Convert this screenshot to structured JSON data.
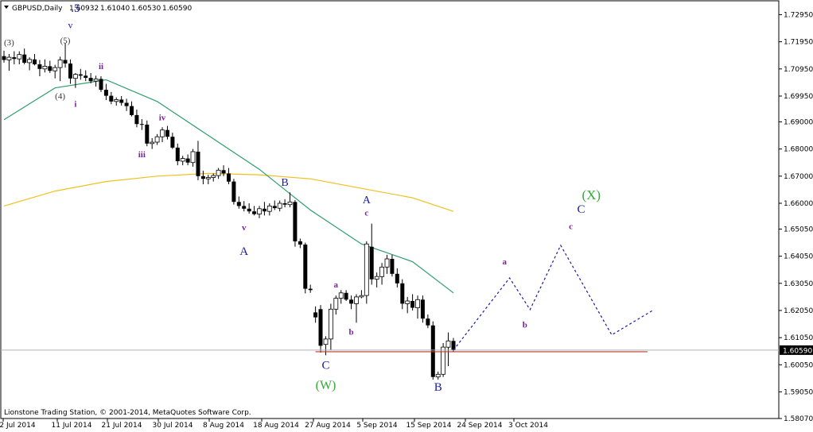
{
  "header": {
    "symbol": "GBPUSD,Daily",
    "open": "1.60932",
    "high": "1.61040",
    "low": "1.60530",
    "close": "1.60590"
  },
  "footer": {
    "copyright": "Lionstone Trading Station, © 2001-2014, MetaQuotes Software Corp."
  },
  "current_price_label": "1.60590",
  "colors": {
    "bull": "#ffffff",
    "bear": "#000000",
    "ma_fast": "#2e9e6a",
    "ma_slow": "#f0c020",
    "projection": "#1a1aa8",
    "support": "#c0392b",
    "wave_blue": "#1a1aa8",
    "wave_purple": "#7a1fa0",
    "wave_green": "#33aa33",
    "wave_black": "#333333"
  },
  "chart_data": {
    "type": "candlestick",
    "y_axis": {
      "min": 1.5807,
      "max": 1.7346,
      "ticks": [
        "1.72950",
        "1.71950",
        "1.70950",
        "1.69950",
        "1.69000",
        "1.68000",
        "1.67000",
        "1.66000",
        "1.65050",
        "1.64050",
        "1.63050",
        "1.62050",
        "1.61050",
        "1.60050",
        "1.59050",
        "1.58070"
      ]
    },
    "x_axis": {
      "labels": [
        "2 Jul 2014",
        "11 Jul 2014",
        "21 Jul 2014",
        "30 Jul 2014",
        "8 Aug 2014",
        "18 Aug 2014",
        "27 Aug 2014",
        "5 Sep 2014",
        "15 Sep 2014",
        "24 Sep 2014",
        "3 Oct 2014"
      ]
    },
    "candles": [
      [
        1.7142,
        1.7162,
        1.7118,
        1.7128
      ],
      [
        1.7128,
        1.715,
        1.7088,
        1.7138
      ],
      [
        1.7138,
        1.716,
        1.7112,
        1.7132
      ],
      [
        1.7132,
        1.716,
        1.7112,
        1.7148
      ],
      [
        1.7148,
        1.717,
        1.7112,
        1.7118
      ],
      [
        1.7118,
        1.7138,
        1.709,
        1.713
      ],
      [
        1.713,
        1.715,
        1.7108,
        1.7112
      ],
      [
        1.7112,
        1.7128,
        1.7068,
        1.7095
      ],
      [
        1.7095,
        1.713,
        1.7082,
        1.7105
      ],
      [
        1.7105,
        1.7125,
        1.708,
        1.7088
      ],
      [
        1.7088,
        1.711,
        1.706,
        1.71
      ],
      [
        1.71,
        1.714,
        1.705,
        1.7128
      ],
      [
        1.7128,
        1.719,
        1.71,
        1.7115
      ],
      [
        1.7115,
        1.713,
        1.704,
        1.706
      ],
      [
        1.706,
        1.708,
        1.7025,
        1.7075
      ],
      [
        1.7075,
        1.7095,
        1.7055,
        1.707
      ],
      [
        1.707,
        1.709,
        1.705,
        1.7062
      ],
      [
        1.7062,
        1.708,
        1.7042,
        1.705
      ],
      [
        1.705,
        1.707,
        1.703,
        1.7058
      ],
      [
        1.7058,
        1.7068,
        1.701,
        1.7018
      ],
      [
        1.7018,
        1.704,
        1.698,
        1.6996
      ],
      [
        1.6996,
        1.701,
        1.6965,
        1.6975
      ],
      [
        1.6975,
        1.699,
        1.696,
        1.6982
      ],
      [
        1.6982,
        1.6995,
        1.696,
        1.697
      ],
      [
        1.697,
        1.6985,
        1.694,
        1.6958
      ],
      [
        1.6958,
        1.6975,
        1.692,
        1.6925
      ],
      [
        1.6925,
        1.6945,
        1.688,
        1.6892
      ],
      [
        1.6892,
        1.691,
        1.687,
        1.689
      ],
      [
        1.689,
        1.6905,
        1.681,
        1.682
      ],
      [
        1.682,
        1.684,
        1.68,
        1.6825
      ],
      [
        1.6825,
        1.6855,
        1.6815,
        1.6845
      ],
      [
        1.6845,
        1.688,
        1.6825,
        1.687
      ],
      [
        1.687,
        1.6885,
        1.6835,
        1.6845
      ],
      [
        1.6845,
        1.686,
        1.68,
        1.6805
      ],
      [
        1.6805,
        1.682,
        1.674,
        1.6755
      ],
      [
        1.6755,
        1.6775,
        1.674,
        1.6765
      ],
      [
        1.6765,
        1.678,
        1.674,
        1.675
      ],
      [
        1.675,
        1.68,
        1.6735,
        1.679
      ],
      [
        1.679,
        1.683,
        1.6685,
        1.67
      ],
      [
        1.67,
        1.672,
        1.667,
        1.669
      ],
      [
        1.669,
        1.6705,
        1.667,
        1.6695
      ],
      [
        1.6695,
        1.671,
        1.668,
        1.6702
      ],
      [
        1.6702,
        1.673,
        1.669,
        1.6722
      ],
      [
        1.6722,
        1.674,
        1.67,
        1.671
      ],
      [
        1.671,
        1.673,
        1.667,
        1.668
      ],
      [
        1.668,
        1.669,
        1.6595,
        1.6605
      ],
      [
        1.6605,
        1.6625,
        1.658,
        1.659
      ],
      [
        1.659,
        1.6608,
        1.657,
        1.658
      ],
      [
        1.658,
        1.66,
        1.6562,
        1.657
      ],
      [
        1.657,
        1.659,
        1.6555,
        1.656
      ],
      [
        1.656,
        1.659,
        1.6545,
        1.658
      ],
      [
        1.658,
        1.6605,
        1.6555,
        1.657
      ],
      [
        1.657,
        1.66,
        1.6555,
        1.659
      ],
      [
        1.659,
        1.661,
        1.6575,
        1.6582
      ],
      [
        1.6582,
        1.661,
        1.657,
        1.66
      ],
      [
        1.66,
        1.6615,
        1.6585,
        1.6595
      ],
      [
        1.6595,
        1.664,
        1.6585,
        1.6605
      ],
      [
        1.6605,
        1.6612,
        1.644,
        1.646
      ],
      [
        1.646,
        1.647,
        1.6435,
        1.6448
      ],
      [
        1.6448,
        1.6455,
        1.6268,
        1.6285
      ],
      [
        1.6285,
        1.63,
        1.627,
        1.628
      ],
      [
        1.6198,
        1.622,
        1.616,
        1.618
      ],
      [
        1.621,
        1.6225,
        1.605,
        1.6075
      ],
      [
        1.608,
        1.611,
        1.604,
        1.61
      ],
      [
        1.61,
        1.623,
        1.606,
        1.621
      ],
      [
        1.621,
        1.626,
        1.619,
        1.625
      ],
      [
        1.625,
        1.628,
        1.623,
        1.627
      ],
      [
        1.627,
        1.628,
        1.624,
        1.6245
      ],
      [
        1.6245,
        1.626,
        1.621,
        1.623
      ],
      [
        1.623,
        1.6265,
        1.616,
        1.6255
      ],
      [
        1.6255,
        1.628,
        1.625,
        1.626
      ],
      [
        1.626,
        1.646,
        1.623,
        1.645
      ],
      [
        1.644,
        1.6525,
        1.63,
        1.632
      ],
      [
        1.632,
        1.6345,
        1.629,
        1.633
      ],
      [
        1.633,
        1.638,
        1.63,
        1.6365
      ],
      [
        1.6365,
        1.641,
        1.634,
        1.6395
      ],
      [
        1.6395,
        1.641,
        1.633,
        1.634
      ],
      [
        1.634,
        1.636,
        1.629,
        1.6305
      ],
      [
        1.6305,
        1.632,
        1.621,
        1.623
      ],
      [
        1.623,
        1.6255,
        1.6195,
        1.624
      ],
      [
        1.624,
        1.6265,
        1.6205,
        1.6215
      ],
      [
        1.6215,
        1.626,
        1.6175,
        1.6245
      ],
      [
        1.6245,
        1.626,
        1.616,
        1.6175
      ],
      [
        1.6175,
        1.619,
        1.614,
        1.615
      ],
      [
        1.615,
        1.6165,
        1.595,
        1.596
      ],
      [
        1.596,
        1.598,
        1.595,
        1.597
      ],
      [
        1.597,
        1.6085,
        1.596,
        1.607
      ],
      [
        1.607,
        1.6124,
        1.6,
        1.6093
      ],
      [
        1.6093,
        1.6104,
        1.6053,
        1.6059
      ]
    ],
    "ma_fast": [
      [
        0,
        1.6908
      ],
      [
        10,
        1.7025
      ],
      [
        20,
        1.7055
      ],
      [
        30,
        1.6975
      ],
      [
        40,
        1.685
      ],
      [
        50,
        1.6725
      ],
      [
        60,
        1.6575
      ],
      [
        70,
        1.645
      ],
      [
        80,
        1.6385
      ],
      [
        88,
        1.627
      ]
    ],
    "ma_slow": [
      [
        0,
        1.659
      ],
      [
        10,
        1.6645
      ],
      [
        20,
        1.668
      ],
      [
        30,
        1.67
      ],
      [
        40,
        1.671
      ],
      [
        50,
        1.6705
      ],
      [
        60,
        1.669
      ],
      [
        70,
        1.6655
      ],
      [
        80,
        1.662
      ],
      [
        88,
        1.657
      ]
    ],
    "projection": [
      [
        88,
        1.6059
      ],
      [
        99,
        1.6325
      ],
      [
        103,
        1.6208
      ],
      [
        109,
        1.6445
      ],
      [
        119,
        1.6115
      ],
      [
        127,
        1.6205
      ]
    ],
    "support_level": 1.6053,
    "current_price": 1.6059,
    "wave_labels": [
      {
        "text": "(3)",
        "i": 1,
        "y": 1.7182,
        "style": "wave_black",
        "size": 11
      },
      {
        "text": "(5)",
        "i": 12,
        "y": 1.719,
        "style": "wave_black",
        "size": 11
      },
      {
        "text": "v",
        "i": 13,
        "y": 1.7245,
        "style": "wave_blue",
        "size": 12
      },
      {
        "text": ".5",
        "i": 14,
        "y": 1.7305,
        "style": "wave_blue",
        "size": 15
      },
      {
        "text": "(4)",
        "i": 11,
        "y": 1.6985,
        "style": "wave_black",
        "size": 11
      },
      {
        "text": "ii",
        "i": 19,
        "y": 1.7095,
        "style": "wave_purple",
        "size": 11
      },
      {
        "text": "i",
        "i": 14,
        "y": 1.6955,
        "style": "wave_purple",
        "size": 11
      },
      {
        "text": "iv",
        "i": 31,
        "y": 1.6905,
        "style": "wave_purple",
        "size": 11
      },
      {
        "text": "iii",
        "i": 27,
        "y": 1.677,
        "style": "wave_purple",
        "size": 11
      },
      {
        "text": "B",
        "i": 55,
        "y": 1.6665,
        "style": "wave_blue",
        "size": 14
      },
      {
        "text": "v",
        "i": 47,
        "y": 1.65,
        "style": "wave_purple",
        "size": 11
      },
      {
        "text": "A",
        "i": 47,
        "y": 1.641,
        "style": "wave_blue",
        "size": 15
      },
      {
        "text": "A",
        "i": 71,
        "y": 1.66,
        "style": "wave_blue",
        "size": 14
      },
      {
        "text": "c",
        "i": 71,
        "y": 1.6555,
        "style": "wave_purple",
        "size": 11
      },
      {
        "text": "a",
        "i": 65,
        "y": 1.629,
        "style": "wave_purple",
        "size": 11
      },
      {
        "text": "b",
        "i": 68,
        "y": 1.6115,
        "style": "wave_purple",
        "size": 11
      },
      {
        "text": "C",
        "i": 63,
        "y": 1.599,
        "style": "wave_blue",
        "size": 15
      },
      {
        "text": "(W)",
        "i": 63,
        "y": 1.5915,
        "style": "wave_green",
        "size": 16
      },
      {
        "text": "B",
        "i": 85,
        "y": 1.591,
        "style": "wave_blue",
        "size": 15
      },
      {
        "text": "a",
        "i": 98,
        "y": 1.6375,
        "style": "wave_purple",
        "size": 11
      },
      {
        "text": "b",
        "i": 102,
        "y": 1.6142,
        "style": "wave_purple",
        "size": 11
      },
      {
        "text": "c",
        "i": 111,
        "y": 1.6505,
        "style": "wave_purple",
        "size": 11
      },
      {
        "text": "C",
        "i": 113,
        "y": 1.6565,
        "style": "wave_blue",
        "size": 15
      },
      {
        "text": "(X)",
        "i": 115,
        "y": 1.6615,
        "style": "wave_green",
        "size": 17
      }
    ]
  }
}
